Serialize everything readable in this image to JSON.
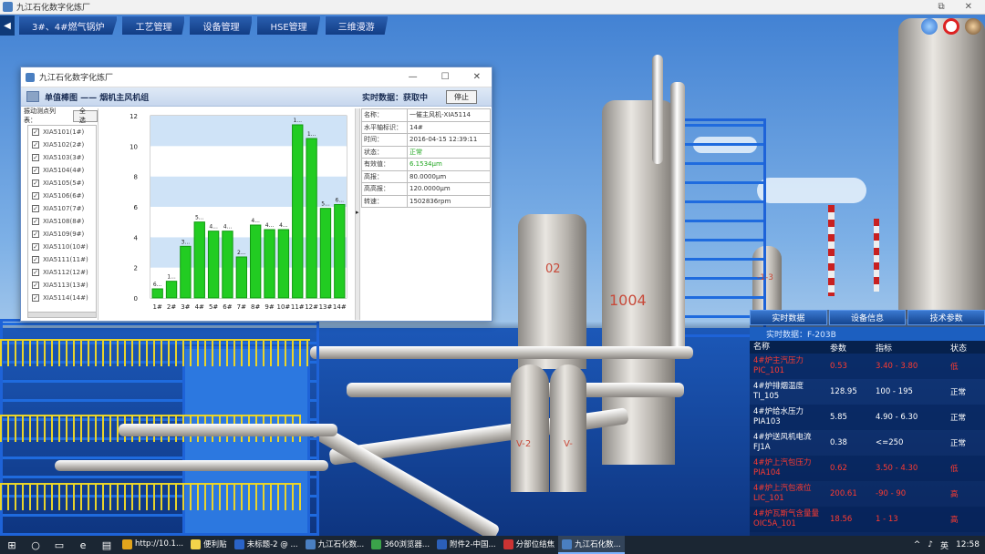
{
  "window_title": "九江石化数字化炼厂",
  "nav": {
    "back_icon": "chevron-left-icon",
    "tabs": [
      "3#、4#燃气锅炉",
      "工艺管理",
      "设备管理",
      "HSE管理",
      "三维漫游"
    ]
  },
  "title_controls": {
    "restore": "⧉",
    "close": "✕"
  },
  "top_icons": [
    "bell-icon",
    "no-entry-icon",
    "user-icon"
  ],
  "scene_labels": {
    "tower_tag": "1004",
    "vessel_tag": "02",
    "v2": "V-2",
    "v": "V-",
    "tower3": "-1-3"
  },
  "dialog": {
    "title": "九江石化数字化炼厂",
    "controls": {
      "minimize": "—",
      "maximize": "☐",
      "close": "✕"
    },
    "header_title": "单值棒图 —— 烟机主风机组",
    "realtime_label": "实时数据：获取中",
    "stop_button": "停止",
    "point_list_label": "振动测点列表：",
    "all_button": "全选",
    "points": [
      "XIA5101(1#)",
      "XIA5102(2#)",
      "XIA5103(3#)",
      "XIA5104(4#)",
      "XIA5105(5#)",
      "XIA5106(6#)",
      "XIA5107(7#)",
      "XIA5108(8#)",
      "XIA5109(9#)",
      "XIA5110(10#)",
      "XIA5111(11#)",
      "XIA5112(12#)",
      "XIA5113(13#)",
      "XIA5114(14#)"
    ],
    "properties": [
      {
        "key": "名称：",
        "value": "一催主风机-XIA5114"
      },
      {
        "key": "水平轴标识：",
        "value": "14#"
      },
      {
        "key": "时间：",
        "value": "2016-04-15 12:39:11"
      },
      {
        "key": "状态：",
        "value": "正常",
        "ok": true
      },
      {
        "key": "有效值：",
        "value": "6.1534μm",
        "ok": true
      },
      {
        "key": "高报：",
        "value": "80.0000μm"
      },
      {
        "key": "高高报：",
        "value": "120.0000μm"
      },
      {
        "key": "转速：",
        "value": "1502836rpm"
      }
    ]
  },
  "chart_data": {
    "type": "bar",
    "categories": [
      "1#",
      "2#",
      "3#",
      "4#",
      "5#",
      "6#",
      "7#",
      "8#",
      "9#",
      "10#",
      "11#",
      "12#",
      "13#",
      "14#"
    ],
    "values": [
      0.6,
      1.1,
      3.4,
      5.0,
      4.4,
      4.4,
      2.7,
      4.8,
      4.5,
      4.5,
      11.4,
      10.5,
      5.9,
      6.15
    ],
    "data_labels": [
      "6...",
      "1...",
      "3...",
      "5...",
      "4...",
      "4...",
      "2...",
      "4...",
      "4...",
      "4...",
      "1...",
      "1...",
      "5...",
      "6..."
    ],
    "ylim": [
      0,
      12
    ],
    "yticks": [
      0,
      2,
      4,
      6,
      8,
      10,
      12
    ],
    "bar_color": "#22cc22",
    "band_colors": [
      "#ffffff",
      "#cfe3f7"
    ]
  },
  "right_panel": {
    "tabs": [
      "实时数据",
      "设备信息",
      "技术参数"
    ],
    "subtitle": "实时数据：F-203B",
    "columns": [
      "名称",
      "参数",
      "指标",
      "状态"
    ],
    "rows": [
      {
        "name": "4#炉主汽压力PIC_101",
        "value": "0.53",
        "range": "3.40 - 3.80",
        "status": "低",
        "alarm": true
      },
      {
        "name": "4#炉排烟温度TI_105",
        "value": "128.95",
        "range": "100 - 195",
        "status": "正常",
        "alarm": false
      },
      {
        "name": "4#炉给水压力PIA103",
        "value": "5.85",
        "range": "4.90 - 6.30",
        "status": "正常",
        "alarm": false
      },
      {
        "name": "4#炉送风机电流FJ1A",
        "value": "0.38",
        "range": "<=250",
        "status": "正常",
        "alarm": false
      },
      {
        "name": "4#炉上汽包压力PIA104",
        "value": "0.62",
        "range": "3.50 - 4.30",
        "status": "低",
        "alarm": true
      },
      {
        "name": "4#炉上汽包液位LIC_101",
        "value": "200.61",
        "range": "-90 - 90",
        "status": "高",
        "alarm": true
      },
      {
        "name": "4#炉瓦斯气含量量OIC5A_101",
        "value": "18.56",
        "range": "1 - 13",
        "status": "高",
        "alarm": true
      }
    ]
  },
  "taskbar": {
    "items": [
      {
        "label": "http://10.1...",
        "color": "#e2a41c"
      },
      {
        "label": "便利贴",
        "color": "#f3d34a"
      },
      {
        "label": "未标题-2 @ ...",
        "color": "#2a63c7"
      },
      {
        "label": "九江石化数...",
        "color": "#4a7fc1"
      },
      {
        "label": "360浏览器...",
        "color": "#3ba34a"
      },
      {
        "label": "附件2-中国...",
        "color": "#2b5fb8"
      },
      {
        "label": "分部位结焦",
        "color": "#c33"
      },
      {
        "label": "九江石化数...",
        "color": "#4a7fc1",
        "active": true
      }
    ],
    "lang": "英",
    "time": "12:58"
  }
}
